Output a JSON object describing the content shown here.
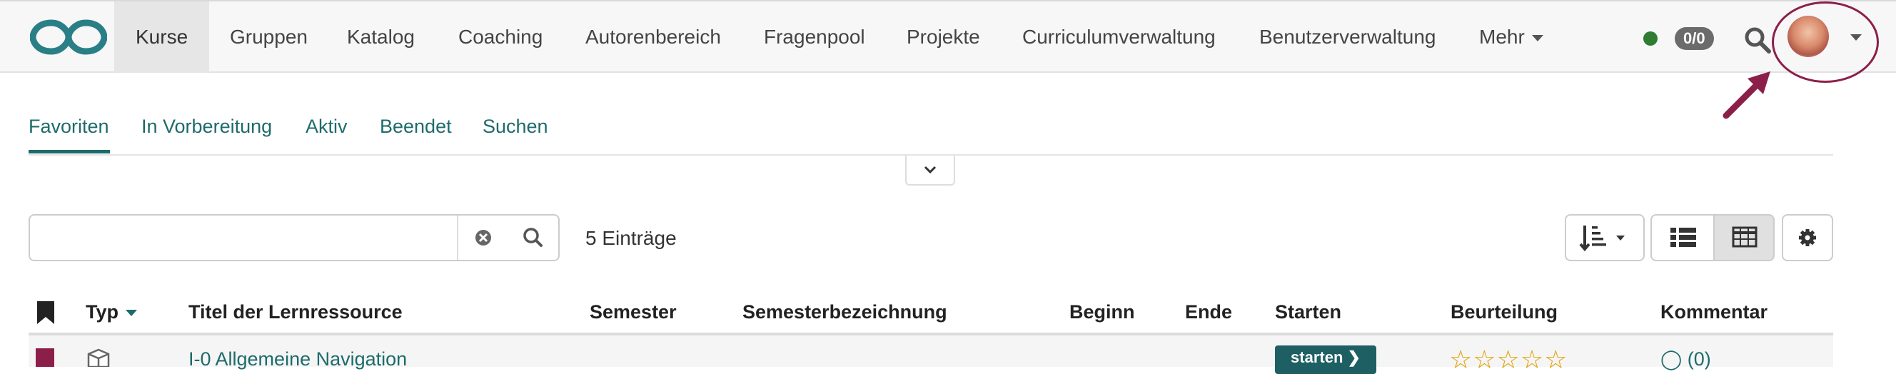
{
  "navbar": {
    "items": [
      {
        "label": "Kurse",
        "active": true
      },
      {
        "label": "Gruppen"
      },
      {
        "label": "Katalog"
      },
      {
        "label": "Coaching"
      },
      {
        "label": "Autorenbereich"
      },
      {
        "label": "Fragenpool"
      },
      {
        "label": "Projekte"
      },
      {
        "label": "Curriculumverwaltung"
      },
      {
        "label": "Benutzerverwaltung"
      },
      {
        "label": "Mehr"
      }
    ],
    "badge": "0/0",
    "status_color": "#2e7d32",
    "accent": "#8c1f4a"
  },
  "tabs": [
    {
      "label": "Favoriten",
      "active": true
    },
    {
      "label": "In Vorbereitung"
    },
    {
      "label": "Aktiv"
    },
    {
      "label": "Beendet"
    },
    {
      "label": "Suchen"
    }
  ],
  "search": {
    "value": "",
    "placeholder": ""
  },
  "count": "5 Einträge",
  "table": {
    "headers": [
      "Typ",
      "Titel der Lernressource",
      "Semester",
      "Semesterbezeichnung",
      "Beginn",
      "Ende",
      "Starten",
      "Beurteilung",
      "Kommentar"
    ],
    "rows": [
      {
        "title": "I-0 Allgemeine Navigation",
        "start_label": "starten",
        "stars": "☆☆☆☆☆",
        "comments": "(0)"
      }
    ]
  },
  "colors": {
    "primary": "#1e6b6b",
    "button": "#1e5f63",
    "star": "#e0a000"
  }
}
